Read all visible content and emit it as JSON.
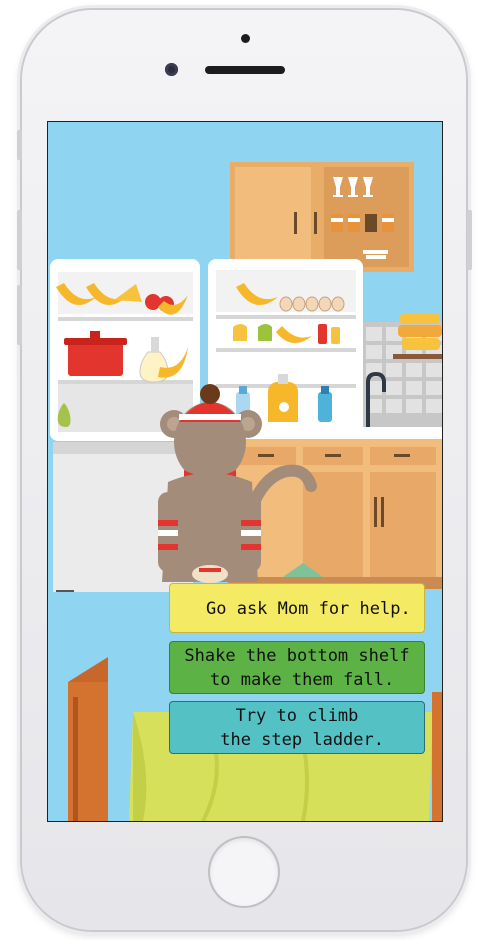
{
  "device": {
    "model": "iphone",
    "frame_color": "#f0f0f2"
  },
  "scene": {
    "setting": "kitchen",
    "background_color": "#8fd4f0",
    "character": "sock-monkey-wearing-striped-beanie"
  },
  "choices": [
    {
      "id": "ask-mom",
      "lines": [
        "Go ask Mom for help."
      ],
      "color": "#f5ea63"
    },
    {
      "id": "shake-shelf",
      "lines": [
        "Shake the bottom shelf",
        " to make them fall."
      ],
      "color": "#5cb244"
    },
    {
      "id": "step-ladder",
      "lines": [
        "Try to climb",
        " the step ladder."
      ],
      "color": "#54c2c5"
    }
  ]
}
